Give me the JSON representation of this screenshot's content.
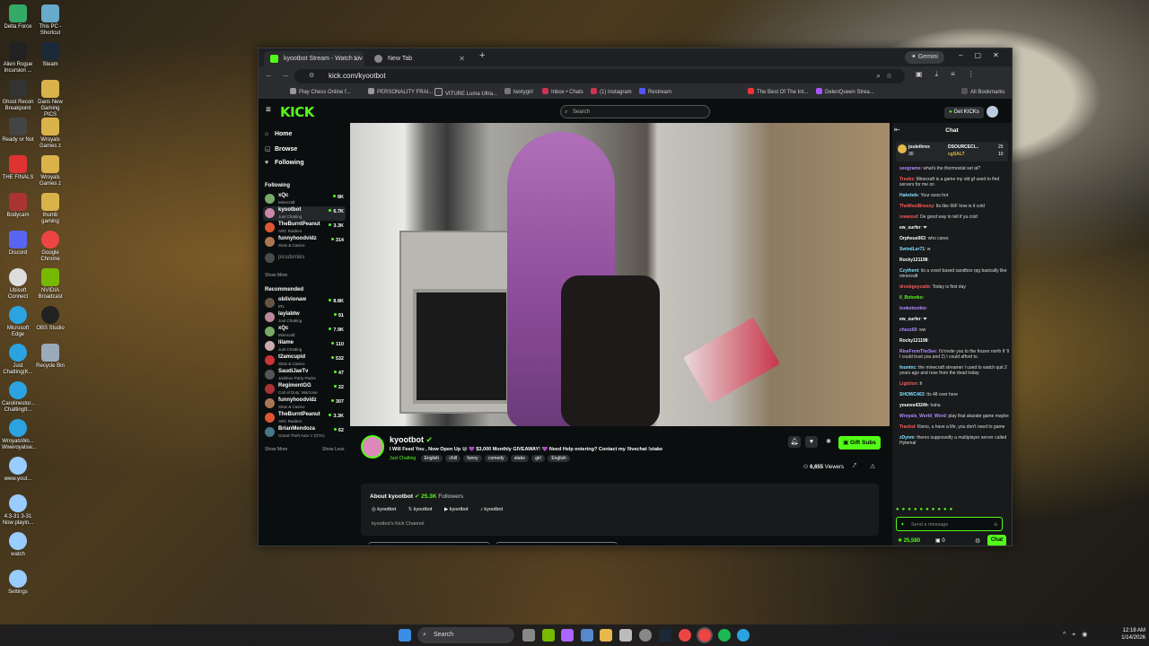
{
  "desktop": {
    "icons": [
      "Delta Force",
      "This PC - Shortcut",
      "Alien Rogue Incursion ...",
      "Steam",
      "Ghost Recon Breakpoint",
      "Dans New Gaming PICS",
      "Ready or Not",
      "Wroyals Games z",
      "THE FINALS",
      "Wroyals Games z",
      "Bodycam",
      "thumb gaming",
      "Discord",
      "Google Chrome",
      "Ubisoft Connect",
      "NVIDIA Broadcast",
      "Microsoft Edge",
      "OBS Studio",
      "Just Chatting(K...",
      "Recycle Bin",
      "Carolinestor... ChattingIt...",
      "WroyalsWo... Wweroyalsw...",
      "www.yout...",
      "4:3-31 3-31 Now playin...",
      "watch",
      "Settings"
    ]
  },
  "browser": {
    "tabs": [
      {
        "title": "kyootbot Stream - Watch Liv",
        "active": true
      },
      {
        "title": "New Tab",
        "active": false
      }
    ],
    "gemini_label": "Gemini",
    "url": "kick.com/kyootbot",
    "bookmarks": [
      "Play Chess Online f...",
      "PERSONALITY FRAI...",
      "VITURE Luma Ultra...",
      "twxtygirl",
      "Inbox • Chats",
      "(1) Instagram",
      "Restream",
      "The Best Of The Int...",
      "DelenQueen Strea...",
      "All Bookmarks"
    ]
  },
  "kick": {
    "logo": "KICK",
    "search_placeholder": "Search",
    "get_kicks": "Get KICKs",
    "nav": [
      {
        "icon": "home-icon",
        "label": "Home"
      },
      {
        "icon": "browse-icon",
        "label": "Browse"
      },
      {
        "icon": "following-icon",
        "label": "Following"
      }
    ],
    "following_header": "Following",
    "following": [
      {
        "name": "xQc",
        "category": "Minecraft",
        "viewers": "8K"
      },
      {
        "name": "kyootbot",
        "category": "Just Chatting",
        "viewers": "6.7K"
      },
      {
        "name": "TheBurntPeanut",
        "category": "ARC Raiders",
        "viewers": "3.3K"
      },
      {
        "name": "funnyhoodvidz",
        "category": "Slots & Casino",
        "viewers": "314"
      },
      {
        "name": "picsdxmiks",
        "category": "",
        "viewers": ""
      }
    ],
    "show_more": "Show More",
    "recommended_header": "Recommended",
    "recommended": [
      {
        "name": "oblivionaw",
        "category": "IRL",
        "viewers": "8.8K"
      },
      {
        "name": "laylabtw",
        "category": "Just Chatting",
        "viewers": "91"
      },
      {
        "name": "xQc",
        "category": "Minecraft",
        "viewers": "7.9K"
      },
      {
        "name": "lilame",
        "category": "Just Chatting",
        "viewers": "110"
      },
      {
        "name": "t2amcupid",
        "category": "Slots & Casino",
        "viewers": "532"
      },
      {
        "name": "SaudiJaeTv",
        "category": "Jackbox Party Packs",
        "viewers": "47"
      },
      {
        "name": "RegimentGG",
        "category": "Call of Duty: Warzone",
        "viewers": "22"
      },
      {
        "name": "funnyhoodvidz",
        "category": "Slots & Casino",
        "viewers": "307"
      },
      {
        "name": "TheBurntPeanut",
        "category": "ARC Raiders",
        "viewers": "3.3K"
      },
      {
        "name": "BrianMendoza",
        "category": "Grand Theft Auto V (GTA)",
        "viewers": "62"
      }
    ],
    "show_less": "Show Less",
    "streamer": {
      "name": "kyootbot",
      "title": "I Will Feed You , Now Open Up 😄 💜 $3,000 Monthly GIVEAWAY! 💜 Need Help entering? Contact my !livechat !stake",
      "category": "Just Chatting",
      "tags": [
        "English",
        "chill",
        "funny",
        "comedy",
        "stake",
        "girl",
        "English"
      ],
      "viewers": "6,655",
      "viewers_label": "Viewers",
      "gift_subs": "Gift Subs"
    },
    "about": {
      "title": "About kyootbot",
      "followers": "25.3K",
      "followers_label": "Followers",
      "socials": [
        "kyootbot",
        "kyootbot",
        "kyootbot",
        "kyootbot"
      ],
      "description": "kyootbot's Kick Channel"
    },
    "chat": {
      "title": "Chat",
      "leaders": [
        {
          "name": "joulethrex",
          "count": "30"
        },
        {
          "name": "DSOURCECI...",
          "count": "25"
        },
        {
          "name": "cgSALT",
          "count": "10"
        }
      ],
      "messages": [
        {
          "user": "seograms",
          "color": "#b58cff",
          "text": "what's the thermostat set at?"
        },
        {
          "user": "Trexbz",
          "color": "#ff5b5b",
          "text": "Minecraft is a game my old gf used to find servers for me on"
        },
        {
          "user": "Hakebds",
          "color": "#7ee0ff",
          "text": "Your sooo hot"
        },
        {
          "user": "TheWestBrooxy",
          "color": "#ff5b5b",
          "text": "Its like 66F how is it cold"
        },
        {
          "user": "rewexsd",
          "color": "#ff5b5b",
          "text": "Oe good way to tell if ya cold"
        },
        {
          "user": "ew_surfer",
          "color": "#fff",
          "text": "❤"
        },
        {
          "user": "Orpheus063",
          "color": "#fff",
          "text": "who cares"
        },
        {
          "user": "SwindLer71",
          "color": "#7ee0ff",
          "text": "w"
        },
        {
          "user": "Rocky121198",
          "color": "#fff",
          "text": ""
        },
        {
          "user": "Czythent",
          "color": "#7ee0ff",
          "text": "its a voxel based sandbox rpg basically like minecraft"
        },
        {
          "user": "drexbgoycatle",
          "color": "#ff5b5b",
          "text": "Today is first day"
        },
        {
          "user": "Il_Botonko",
          "color": "#53fc18",
          "text": ""
        },
        {
          "user": "tonkebonkio",
          "color": "#b58cff",
          "text": ""
        },
        {
          "user": "ew_surfer",
          "color": "#fff",
          "text": "❤"
        },
        {
          "user": "chezz69",
          "color": "#b58cff",
          "text": "ww"
        },
        {
          "user": "Rocky121198",
          "color": "#fff",
          "text": ""
        },
        {
          "user": "RiseFromTheSee",
          "color": "#b58cff",
          "text": "I'd invite you to the frozen north If 'll I could trust you and 2) I could afford to."
        },
        {
          "user": "fountnc",
          "color": "#7ee0ff",
          "text": "the minecraft streamer I used to watch quit 2 years ago and rose from the dead today"
        },
        {
          "user": "Ligtolon",
          "color": "#ff5b5b",
          "text": "fr"
        },
        {
          "user": "SHOWC463",
          "color": "#7ee0ff",
          "text": "Its 48 over here"
        },
        {
          "user": "younes4324h",
          "color": "#fff",
          "text": "haha"
        },
        {
          "user": "Wroyals_World_Word",
          "color": "#b58cff",
          "text": "play that akarate game maybe"
        },
        {
          "user": "TracksI",
          "color": "#ff5b5b",
          "text": "Kieno, u have a life, you don't need to game"
        },
        {
          "user": "zDynm",
          "color": "#7ee0ff",
          "text": "theres supposedly a multiplayer server called Hytemal"
        }
      ],
      "placeholder": "Send a message",
      "points": "25,580",
      "other_count": "0",
      "send": "Chat"
    }
  },
  "taskbar": {
    "search": "Search",
    "time": "12:18 AM",
    "date": "1/14/2026"
  }
}
